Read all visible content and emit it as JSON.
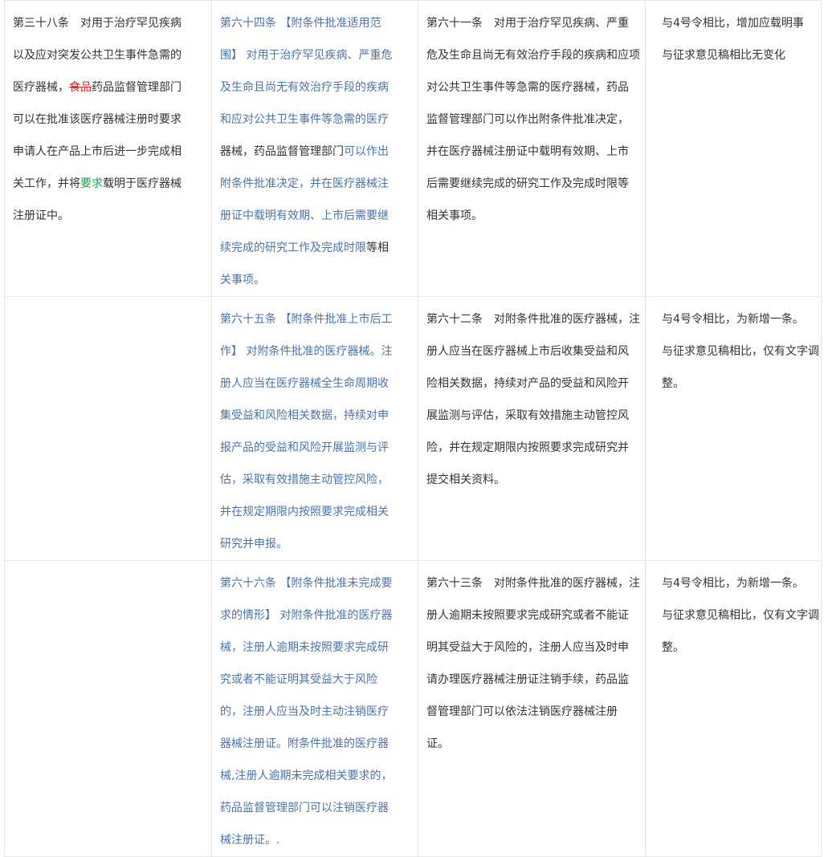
{
  "table": {
    "rows": [
      {
        "col1": [
          "第三十八条　对用于治疗罕见疾病",
          "以及应对突发公共卫生事件急需的",
          {
            "pre": "医疗器械，",
            "del": "食品",
            "post": "药品监督管理部门"
          },
          "可以在批准该医疗器械注册时要求",
          "申请人在产品上市后进一步完成相",
          {
            "pre": "关工作，并将",
            "add": "要求",
            "post": "载明于医疗器械"
          },
          "注册证中。"
        ],
        "col2": [
          "第六十四条 【附条件批准适用范",
          "围】 对用于治疗罕见疾病、严重危",
          "及生命且尚无有效治疗手段的疾病",
          "和应对公共卫生事件等急需的医疗",
          {
            "pre": "器械，药品监督管理部门",
            "blue": "可以作出"
          },
          "附条件批准决定，并在医疗器械注",
          "册证中载明有效期、上市后需要继",
          {
            "blue": "续完成的研究工作及完成时限",
            "post": "等相"
          },
          "关事项。"
        ],
        "col3": [
          "第六十一条　对用于治疗罕见疾病、严重",
          "危及生命且尚无有效治疗手段的疾病和应项",
          "对公共卫生事件等急需的医疗器械，药品",
          "监督管理部门可以作出附条件批准决定，",
          "并在医疗器械注册证中载明有效期、上市",
          "后需要继续完成的研究工作及完成时限等",
          "相关事项。"
        ],
        "col4": [
          "与4号令相比，增加应载明事",
          "与征求意见稿相比无变化"
        ]
      },
      {
        "col1": [],
        "col2": [
          "第六十五条 【附条件批准上市后工",
          "作】 对附条件批准的医疗器械。注",
          "册人应当在医疗器械全生命周期收",
          "集受益和风险相关数据，持续对申",
          "报产品的受益和风险开展监测与评",
          "估，采取有效措施主动管控风险，",
          "并在规定期限内按照要求完成相关",
          "研究并申报。"
        ],
        "col3": [
          "第六十二条　对附条件批准的医疗器械，注",
          "册人应当在医疗器械上市后收集受益和风",
          "险相关数据，持续对产品的受益和风险开",
          "展监测与评估，采取有效措施主动管控风",
          "险，并在规定期限内按照要求完成研究并",
          "提交相关资料。"
        ],
        "col4": [
          "与4号令相比，为新增一条。",
          "与征求意见稿相比，仅有文字调",
          "整。"
        ]
      },
      {
        "col1": [],
        "col2": [
          "第六十六条 【附条件批准未完成要",
          "求的情形】 对附条件批准的医疗器",
          "械，注册人逾期未按照要求完成研",
          "究或者不能证明其受益大于风险",
          "的，注册人应当及时主动注销医疗",
          "器械注册证。附条件批准的医疗器",
          "械,注册人逾期未完成相关要求的，",
          "药品监督管理部门可以注销医疗器",
          "械注册证。."
        ],
        "col3": [
          "第六十三条　对附条件批准的医疗器械，注",
          "册人逾期未按照要求完成研究或者不能证",
          "明其受益大于风险的，注册人应当及时申",
          "请办理医疗器械注册证注销手续，药品监",
          "督管理部门可以依法注销医疗器械注册",
          "证。"
        ],
        "col4": [
          "与4号令相比，为新增一条。",
          "与征求意见稿相比，仅有文字调",
          "整。"
        ]
      }
    ]
  },
  "colors": {
    "text": "#333333",
    "blue": "#4a73a8",
    "deleted": "#e02020",
    "added": "#17a34a",
    "border": "#e6e6e6"
  }
}
